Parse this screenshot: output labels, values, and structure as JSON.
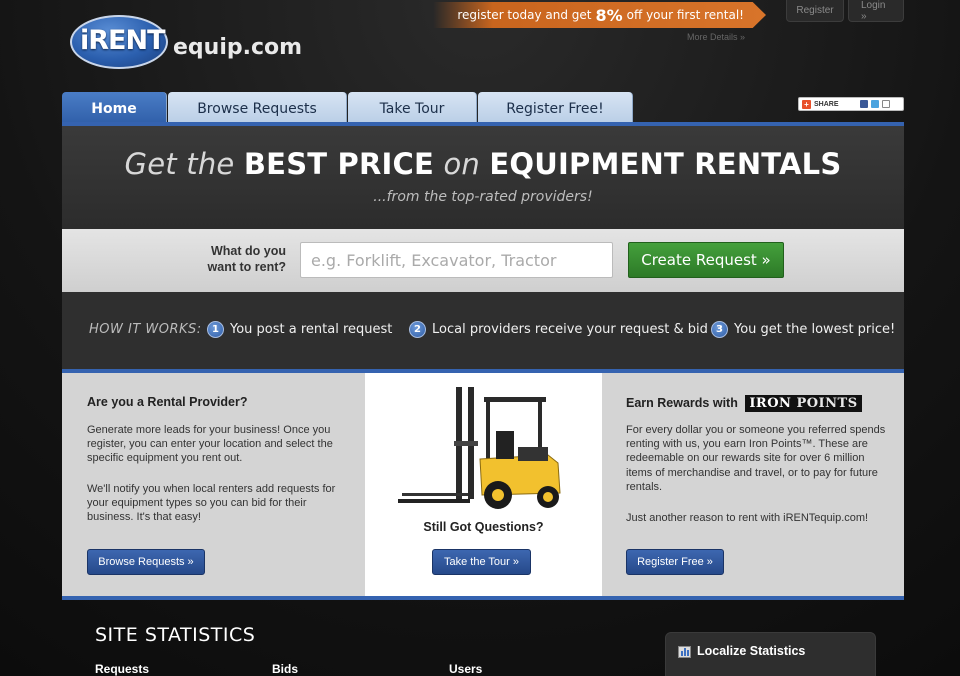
{
  "header": {
    "logo_primary": "iRENT",
    "logo_secondary": "equip.com",
    "promo_prefix": "register today and get",
    "promo_percent": "8%",
    "promo_suffix": "off your first rental!",
    "more_details": "More Details »",
    "register_label": "Register",
    "login_label": "Login »"
  },
  "tabs": [
    {
      "label": "Home",
      "active": true
    },
    {
      "label": "Browse Requests",
      "active": false
    },
    {
      "label": "Take Tour",
      "active": false
    },
    {
      "label": "Register Free!",
      "active": false
    }
  ],
  "share": {
    "label": "SHARE"
  },
  "hero": {
    "title_part1": "Get the",
    "title_part2": "BEST PRICE",
    "title_part3": "on",
    "title_part4": "EQUIPMENT RENTALS",
    "subtitle": "...from the top-rated providers!"
  },
  "search": {
    "label": "What do you want to rent?",
    "placeholder": "e.g. Forklift, Excavator, Tractor",
    "button": "Create Request »"
  },
  "how_it_works": {
    "label": "HOW IT WORKS:",
    "steps": [
      {
        "num": "1",
        "text": "You post a rental request"
      },
      {
        "num": "2",
        "text": "Local providers receive your request & bid"
      },
      {
        "num": "3",
        "text": "You get the lowest price!"
      }
    ]
  },
  "provider": {
    "title": "Are you a Rental Provider?",
    "para1": "Generate more leads for your business! Once you register, you can enter your location and select the specific equipment you rent out.",
    "para2": "We'll notify you when local renters add requests for your equipment types so you can bid for their business. It's that easy!",
    "button": "Browse Requests »"
  },
  "questions": {
    "title": "Still Got Questions?",
    "button": "Take the Tour »"
  },
  "rewards": {
    "title": "Earn Rewards with",
    "brand_iron": "IRON",
    "brand_points": "POINTS",
    "para1": "For every dollar you or someone you referred spends renting with us, you earn Iron Points™. These are redeemable on our rewards site for over 6 million items of merchandise and travel, or to pay for future rentals.",
    "para2": "Just another reason to rent with iRENTequip.com!",
    "button": "Register Free »"
  },
  "stats": {
    "title": "SITE STATISTICS",
    "requests_label": "Requests",
    "bids_label": "Bids",
    "users_label": "Users",
    "localize_title": "Localize Statistics"
  }
}
